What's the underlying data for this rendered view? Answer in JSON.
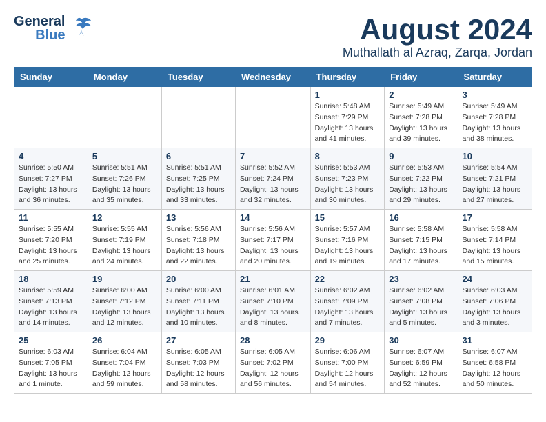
{
  "header": {
    "logo_general": "General",
    "logo_blue": "Blue",
    "month": "August 2024",
    "location": "Muthallath al Azraq, Zarqa, Jordan"
  },
  "weekdays": [
    "Sunday",
    "Monday",
    "Tuesday",
    "Wednesday",
    "Thursday",
    "Friday",
    "Saturday"
  ],
  "weeks": [
    [
      {
        "day": "",
        "info": ""
      },
      {
        "day": "",
        "info": ""
      },
      {
        "day": "",
        "info": ""
      },
      {
        "day": "",
        "info": ""
      },
      {
        "day": "1",
        "info": "Sunrise: 5:48 AM\nSunset: 7:29 PM\nDaylight: 13 hours\nand 41 minutes."
      },
      {
        "day": "2",
        "info": "Sunrise: 5:49 AM\nSunset: 7:28 PM\nDaylight: 13 hours\nand 39 minutes."
      },
      {
        "day": "3",
        "info": "Sunrise: 5:49 AM\nSunset: 7:28 PM\nDaylight: 13 hours\nand 38 minutes."
      }
    ],
    [
      {
        "day": "4",
        "info": "Sunrise: 5:50 AM\nSunset: 7:27 PM\nDaylight: 13 hours\nand 36 minutes."
      },
      {
        "day": "5",
        "info": "Sunrise: 5:51 AM\nSunset: 7:26 PM\nDaylight: 13 hours\nand 35 minutes."
      },
      {
        "day": "6",
        "info": "Sunrise: 5:51 AM\nSunset: 7:25 PM\nDaylight: 13 hours\nand 33 minutes."
      },
      {
        "day": "7",
        "info": "Sunrise: 5:52 AM\nSunset: 7:24 PM\nDaylight: 13 hours\nand 32 minutes."
      },
      {
        "day": "8",
        "info": "Sunrise: 5:53 AM\nSunset: 7:23 PM\nDaylight: 13 hours\nand 30 minutes."
      },
      {
        "day": "9",
        "info": "Sunrise: 5:53 AM\nSunset: 7:22 PM\nDaylight: 13 hours\nand 29 minutes."
      },
      {
        "day": "10",
        "info": "Sunrise: 5:54 AM\nSunset: 7:21 PM\nDaylight: 13 hours\nand 27 minutes."
      }
    ],
    [
      {
        "day": "11",
        "info": "Sunrise: 5:55 AM\nSunset: 7:20 PM\nDaylight: 13 hours\nand 25 minutes."
      },
      {
        "day": "12",
        "info": "Sunrise: 5:55 AM\nSunset: 7:19 PM\nDaylight: 13 hours\nand 24 minutes."
      },
      {
        "day": "13",
        "info": "Sunrise: 5:56 AM\nSunset: 7:18 PM\nDaylight: 13 hours\nand 22 minutes."
      },
      {
        "day": "14",
        "info": "Sunrise: 5:56 AM\nSunset: 7:17 PM\nDaylight: 13 hours\nand 20 minutes."
      },
      {
        "day": "15",
        "info": "Sunrise: 5:57 AM\nSunset: 7:16 PM\nDaylight: 13 hours\nand 19 minutes."
      },
      {
        "day": "16",
        "info": "Sunrise: 5:58 AM\nSunset: 7:15 PM\nDaylight: 13 hours\nand 17 minutes."
      },
      {
        "day": "17",
        "info": "Sunrise: 5:58 AM\nSunset: 7:14 PM\nDaylight: 13 hours\nand 15 minutes."
      }
    ],
    [
      {
        "day": "18",
        "info": "Sunrise: 5:59 AM\nSunset: 7:13 PM\nDaylight: 13 hours\nand 14 minutes."
      },
      {
        "day": "19",
        "info": "Sunrise: 6:00 AM\nSunset: 7:12 PM\nDaylight: 13 hours\nand 12 minutes."
      },
      {
        "day": "20",
        "info": "Sunrise: 6:00 AM\nSunset: 7:11 PM\nDaylight: 13 hours\nand 10 minutes."
      },
      {
        "day": "21",
        "info": "Sunrise: 6:01 AM\nSunset: 7:10 PM\nDaylight: 13 hours\nand 8 minutes."
      },
      {
        "day": "22",
        "info": "Sunrise: 6:02 AM\nSunset: 7:09 PM\nDaylight: 13 hours\nand 7 minutes."
      },
      {
        "day": "23",
        "info": "Sunrise: 6:02 AM\nSunset: 7:08 PM\nDaylight: 13 hours\nand 5 minutes."
      },
      {
        "day": "24",
        "info": "Sunrise: 6:03 AM\nSunset: 7:06 PM\nDaylight: 13 hours\nand 3 minutes."
      }
    ],
    [
      {
        "day": "25",
        "info": "Sunrise: 6:03 AM\nSunset: 7:05 PM\nDaylight: 13 hours\nand 1 minute."
      },
      {
        "day": "26",
        "info": "Sunrise: 6:04 AM\nSunset: 7:04 PM\nDaylight: 12 hours\nand 59 minutes."
      },
      {
        "day": "27",
        "info": "Sunrise: 6:05 AM\nSunset: 7:03 PM\nDaylight: 12 hours\nand 58 minutes."
      },
      {
        "day": "28",
        "info": "Sunrise: 6:05 AM\nSunset: 7:02 PM\nDaylight: 12 hours\nand 56 minutes."
      },
      {
        "day": "29",
        "info": "Sunrise: 6:06 AM\nSunset: 7:00 PM\nDaylight: 12 hours\nand 54 minutes."
      },
      {
        "day": "30",
        "info": "Sunrise: 6:07 AM\nSunset: 6:59 PM\nDaylight: 12 hours\nand 52 minutes."
      },
      {
        "day": "31",
        "info": "Sunrise: 6:07 AM\nSunset: 6:58 PM\nDaylight: 12 hours\nand 50 minutes."
      }
    ]
  ]
}
